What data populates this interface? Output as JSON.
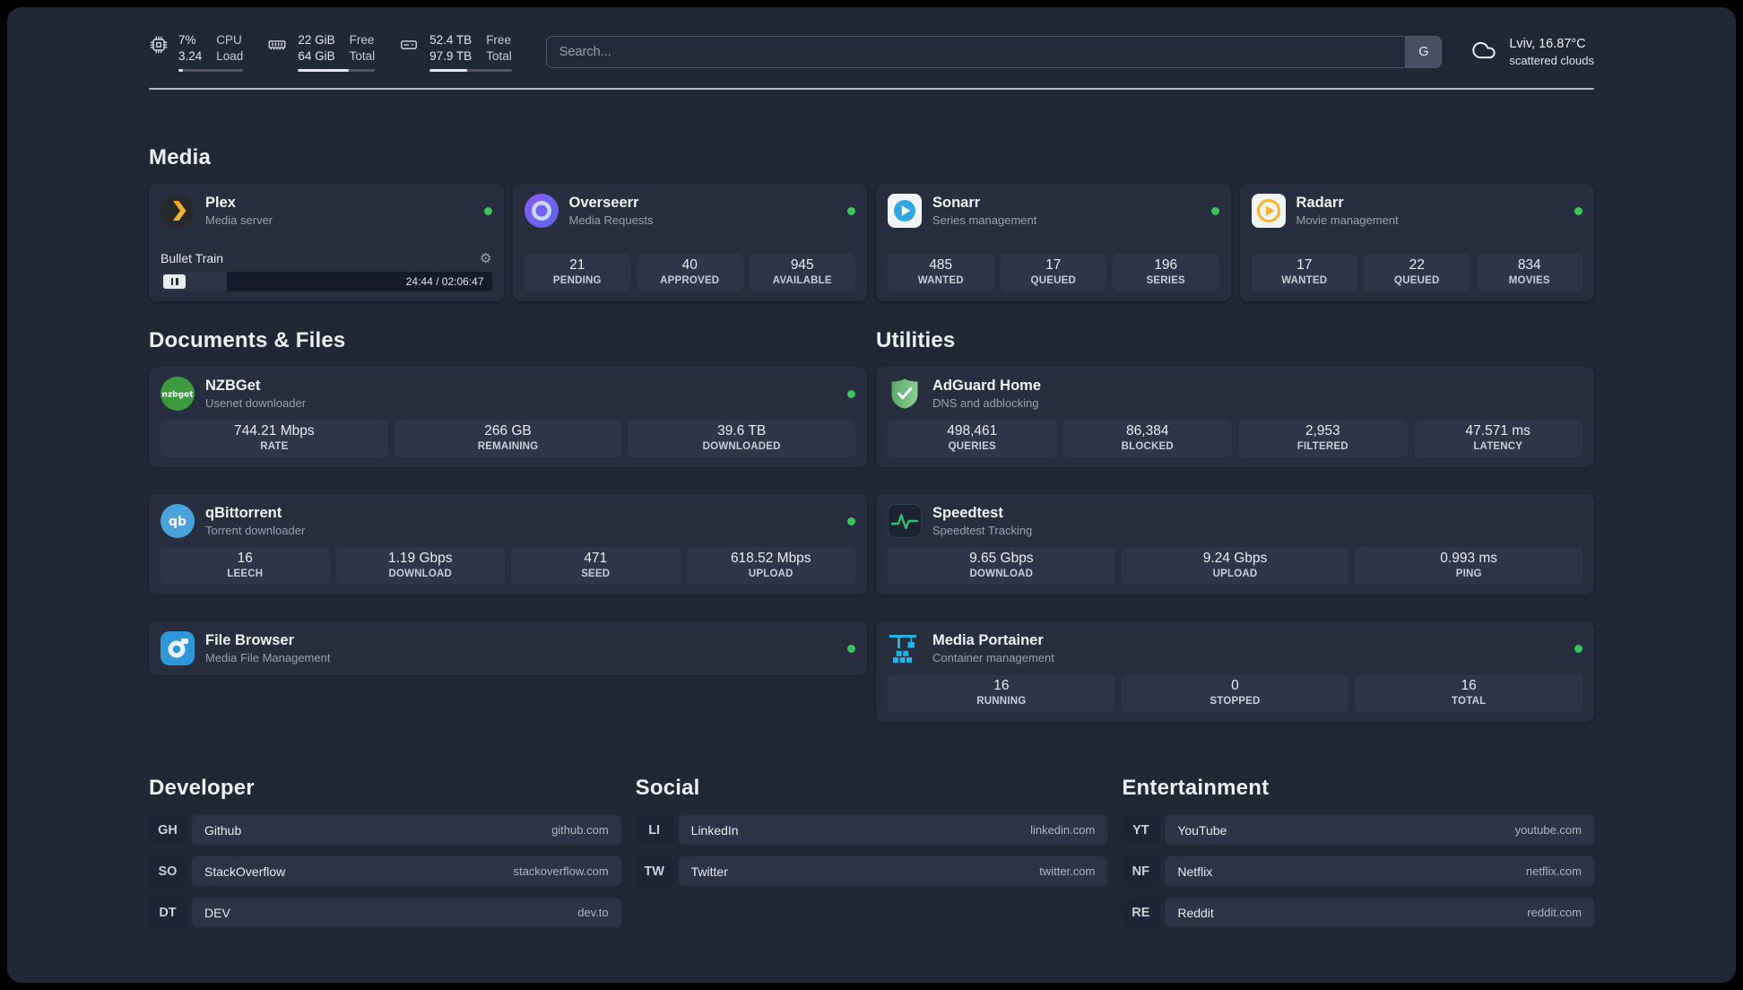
{
  "topbar": {
    "cpu": {
      "value_top": "7%",
      "value_bottom": "3.24",
      "label_top": "CPU",
      "label_bottom": "Load",
      "bar_percent": 7
    },
    "ram": {
      "value_top": "22 GiB",
      "value_bottom": "64 GiB",
      "label_top": "Free",
      "label_bottom": "Total",
      "bar_percent": 66
    },
    "disk": {
      "value_top": "52.4 TB",
      "value_bottom": "97.9 TB",
      "label_top": "Free",
      "label_bottom": "Total",
      "bar_percent": 46
    },
    "search": {
      "placeholder": "Search...",
      "engine_label": "G"
    },
    "weather": {
      "location": "Lviv, 16.87°C",
      "condition": "scattered clouds"
    }
  },
  "sections": {
    "media": "Media",
    "documents": "Documents & Files",
    "utilities": "Utilities"
  },
  "apps": {
    "plex": {
      "name": "Plex",
      "subtitle": "Media server",
      "now_playing": "Bullet Train",
      "time": "24:44 / 02:06:47",
      "progress_percent": 20
    },
    "overseerr": {
      "name": "Overseerr",
      "subtitle": "Media Requests",
      "stats": [
        {
          "value": "21",
          "label": "PENDING"
        },
        {
          "value": "40",
          "label": "APPROVED"
        },
        {
          "value": "945",
          "label": "AVAILABLE"
        }
      ]
    },
    "sonarr": {
      "name": "Sonarr",
      "subtitle": "Series management",
      "stats": [
        {
          "value": "485",
          "label": "WANTED"
        },
        {
          "value": "17",
          "label": "QUEUED"
        },
        {
          "value": "196",
          "label": "SERIES"
        }
      ]
    },
    "radarr": {
      "name": "Radarr",
      "subtitle": "Movie management",
      "stats": [
        {
          "value": "17",
          "label": "WANTED"
        },
        {
          "value": "22",
          "label": "QUEUED"
        },
        {
          "value": "834",
          "label": "MOVIES"
        }
      ]
    },
    "nzbget": {
      "name": "NZBGet",
      "subtitle": "Usenet downloader",
      "stats": [
        {
          "value": "744.21 Mbps",
          "label": "RATE"
        },
        {
          "value": "266 GB",
          "label": "REMAINING"
        },
        {
          "value": "39.6 TB",
          "label": "DOWNLOADED"
        }
      ]
    },
    "qbittorrent": {
      "name": "qBittorrent",
      "subtitle": "Torrent downloader",
      "stats": [
        {
          "value": "16",
          "label": "LEECH"
        },
        {
          "value": "1.19 Gbps",
          "label": "DOWNLOAD"
        },
        {
          "value": "471",
          "label": "SEED"
        },
        {
          "value": "618.52 Mbps",
          "label": "UPLOAD"
        }
      ]
    },
    "filebrowser": {
      "name": "File Browser",
      "subtitle": "Media File Management"
    },
    "adguard": {
      "name": "AdGuard Home",
      "subtitle": "DNS and adblocking",
      "stats": [
        {
          "value": "498,461",
          "label": "QUERIES"
        },
        {
          "value": "86,384",
          "label": "BLOCKED"
        },
        {
          "value": "2,953",
          "label": "FILTERED"
        },
        {
          "value": "47.571 ms",
          "label": "LATENCY"
        }
      ]
    },
    "speedtest": {
      "name": "Speedtest",
      "subtitle": "Speedtest Tracking",
      "stats": [
        {
          "value": "9.65 Gbps",
          "label": "DOWNLOAD"
        },
        {
          "value": "9.24 Gbps",
          "label": "UPLOAD"
        },
        {
          "value": "0.993 ms",
          "label": "PING"
        }
      ]
    },
    "portainer": {
      "name": "Media Portainer",
      "subtitle": "Container management",
      "stats": [
        {
          "value": "16",
          "label": "RUNNING"
        },
        {
          "value": "0",
          "label": "STOPPED"
        },
        {
          "value": "16",
          "label": "TOTAL"
        }
      ]
    }
  },
  "bookmarks": {
    "developer": {
      "title": "Developer",
      "items": [
        {
          "abbr": "GH",
          "name": "Github",
          "url": "github.com"
        },
        {
          "abbr": "SO",
          "name": "StackOverflow",
          "url": "stackoverflow.com"
        },
        {
          "abbr": "DT",
          "name": "DEV",
          "url": "dev.to"
        }
      ]
    },
    "social": {
      "title": "Social",
      "items": [
        {
          "abbr": "LI",
          "name": "LinkedIn",
          "url": "linkedin.com"
        },
        {
          "abbr": "TW",
          "name": "Twitter",
          "url": "twitter.com"
        }
      ]
    },
    "entertainment": {
      "title": "Entertainment",
      "items": [
        {
          "abbr": "YT",
          "name": "YouTube",
          "url": "youtube.com"
        },
        {
          "abbr": "NF",
          "name": "Netflix",
          "url": "netflix.com"
        },
        {
          "abbr": "RE",
          "name": "Reddit",
          "url": "reddit.com"
        }
      ]
    }
  },
  "colors": {
    "status_online": "#3bc45e",
    "background": "#202735",
    "card": "#272e3e",
    "tile": "#2d3547",
    "plex_accent": "#f0b32a",
    "sonarr_accent": "#2fa7e0",
    "radarr_accent": "#ffb127",
    "adguard_accent": "#67b279",
    "speedtest_accent": "#33c170",
    "portainer_accent": "#1fb3e6"
  }
}
